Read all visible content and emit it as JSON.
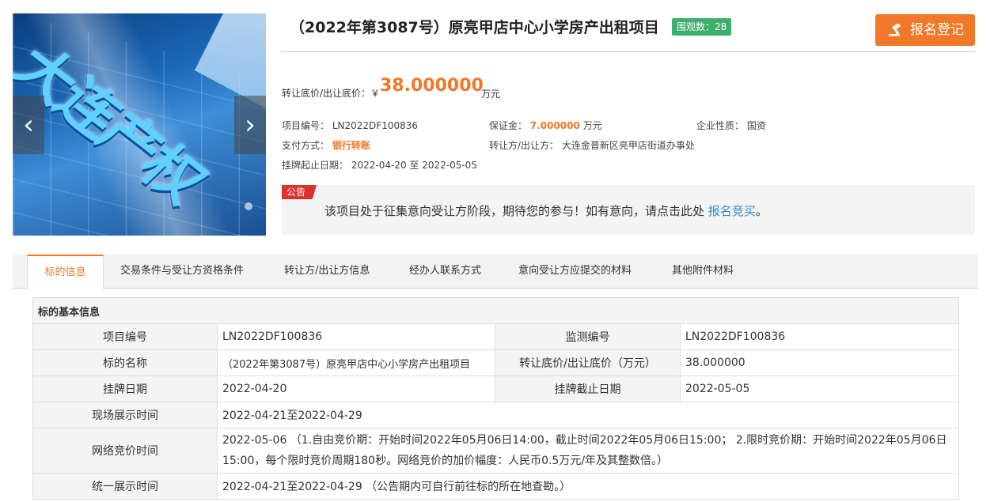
{
  "carousel": {
    "logo_text": "大连产权",
    "prev_icon": "chevron-left-icon",
    "next_icon": "chevron-right-icon"
  },
  "header": {
    "title": "（2022年第3087号）原亮甲店中心小学房产出租项目",
    "views_label": "围观数：28",
    "register_label": "报名登记"
  },
  "price": {
    "label": "转让底价/出让底价：￥",
    "value": "38.000000",
    "unit": "万元"
  },
  "details": {
    "project_no_label": "项目编号：",
    "project_no": "LN2022DF100836",
    "deposit_label": "保证金：",
    "deposit_value": "7.000000",
    "deposit_unit": "万元",
    "enterprise_label": "企业性质：",
    "enterprise_value": "国资",
    "payment_label": "支付方式：",
    "payment_value": "银行转账",
    "transferor_label": "转让方/出让方：",
    "transferor_value": "大连金普新区亮甲店街道办事处",
    "listing_label": "挂牌起止日期：",
    "listing_value": "2022-04-20 至 2022-05-05"
  },
  "notice": {
    "tag": "公告",
    "message": "该项目处于征集意向受让方阶段，期待您的参与！如有意向，请点击此处 ",
    "link": "报名竞买",
    "suffix": "。"
  },
  "tabs": [
    {
      "label": "标的信息"
    },
    {
      "label": "交易条件与受让方资格条件"
    },
    {
      "label": "转让方/出让方信息"
    },
    {
      "label": "经办人联系方式"
    },
    {
      "label": "意向受让方应提交的材料"
    },
    {
      "label": "其他附件材料"
    }
  ],
  "table": {
    "section_title": "标的基本信息",
    "r1": {
      "l1": "项目编号",
      "v1": "LN2022DF100836",
      "l2": "监测编号",
      "v2": "LN2022DF100836"
    },
    "r2": {
      "l1": "标的名称",
      "v1": "（2022年第3087号）原亮甲店中心小学房产出租项目",
      "l2": "转让底价/出让底价（万元）",
      "v2": "38.000000"
    },
    "r3": {
      "l1": "挂牌日期",
      "v1": "2022-04-20",
      "l2": "挂牌截止日期",
      "v2": "2022-05-05"
    },
    "r4": {
      "l1": "现场展示时间",
      "v1": "2022-04-21至2022-04-29"
    },
    "r5": {
      "l1": "网络竞价时间",
      "v1": "2022-05-06 （1.自由竞价期：开始时间2022年05月06日14:00，截止时间2022年05月06日15:00； 2.限时竞价期：开始时间2022年05月06日15:00，每个限时竞价周期180秒。网络竞价的加价幅度：人民币0.5万元/年及其整数倍。）"
    },
    "r6": {
      "l1": "统一展示时间",
      "v1": "2022-04-21至2022-04-29 （公告期内可自行前往标的所在地查勘。）"
    }
  }
}
